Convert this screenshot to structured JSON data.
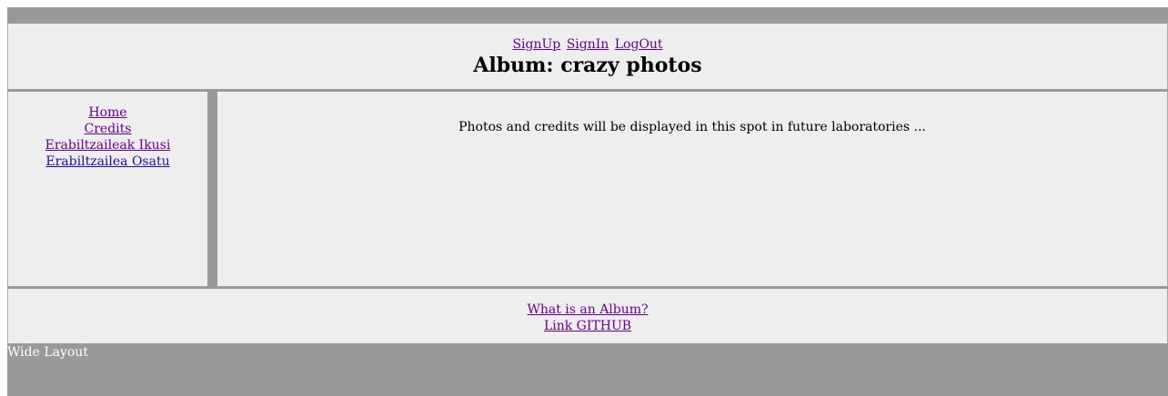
{
  "header": {
    "auth_links": [
      "SignUp",
      "SignIn",
      "LogOut"
    ],
    "title": "Album: crazy photos"
  },
  "nav": {
    "items": [
      "Home",
      "Credits",
      "Erabiltzaileak Ikusi",
      "Erabiltzailea Osatu"
    ]
  },
  "main": {
    "message": "Photos and credits will be displayed in this spot in future laboratories ..."
  },
  "footer": {
    "links": [
      "What is an Album?",
      "Link GITHUB"
    ]
  },
  "bottom": {
    "label": "Wide Layout"
  },
  "colors": {
    "frame": "#999999",
    "panel": "#eeeeee",
    "link": "#1a0dab",
    "visited_link": "#660099"
  }
}
